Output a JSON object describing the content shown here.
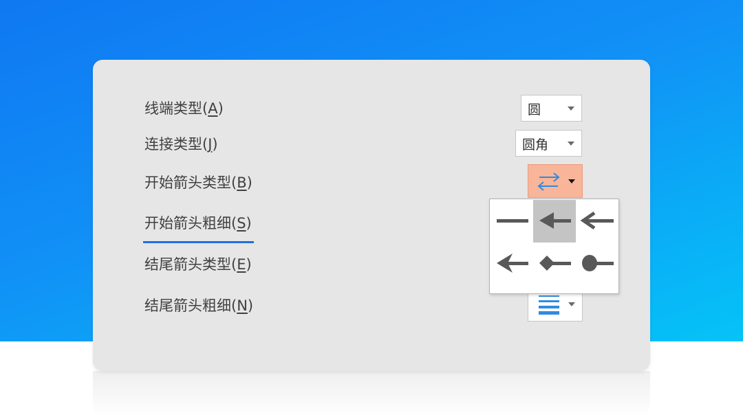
{
  "rows": [
    {
      "label": "线端类型",
      "mnemonic": "A"
    },
    {
      "label": "连接类型",
      "mnemonic": "J"
    },
    {
      "label": "开始箭头类型",
      "mnemonic": "B"
    },
    {
      "label": "开始箭头粗细",
      "mnemonic": "S"
    },
    {
      "label": "结尾箭头类型",
      "mnemonic": "E"
    },
    {
      "label": "结尾箭头粗细",
      "mnemonic": "N"
    }
  ],
  "controls": {
    "cap_type_value": "圆",
    "join_type_value": "圆角",
    "begin_arrow_icon": "double-arrow-icon",
    "end_arrow_width_icon": "line-weight-icon"
  },
  "dropdown": {
    "options": [
      {
        "name": "no-arrow-icon",
        "selected": false
      },
      {
        "name": "solid-arrow-icon",
        "selected": true
      },
      {
        "name": "open-arrow-icon",
        "selected": false
      },
      {
        "name": "stealth-arrow-icon",
        "selected": false
      },
      {
        "name": "diamond-arrow-icon",
        "selected": false
      },
      {
        "name": "oval-arrow-icon",
        "selected": false
      }
    ]
  },
  "colors": {
    "accent_blue": "#1f6fe0",
    "button_highlight": "#f8b599",
    "selected_option": "#c4c4c4",
    "panel": "#e6e6e6"
  }
}
